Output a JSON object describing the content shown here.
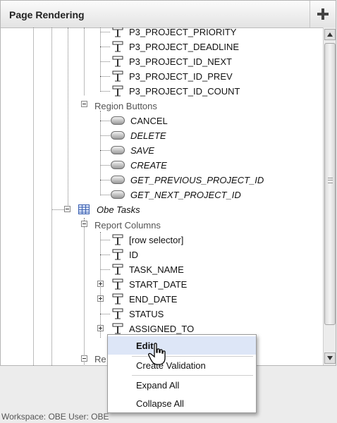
{
  "panel": {
    "title": "Page Rendering",
    "add_label": "+"
  },
  "tree": {
    "items_top": [
      "P3_PROJECT_PRIORITY",
      "P3_PROJECT_DEADLINE",
      "P3_PROJECT_ID_NEXT",
      "P3_PROJECT_ID_PREV",
      "P3_PROJECT_ID_COUNT"
    ],
    "region_buttons": {
      "label": "Region Buttons",
      "buttons": [
        {
          "label": "CANCEL",
          "italic": false
        },
        {
          "label": "DELETE",
          "italic": true
        },
        {
          "label": "SAVE",
          "italic": true
        },
        {
          "label": "CREATE",
          "italic": true
        },
        {
          "label": "GET_PREVIOUS_PROJECT_ID",
          "italic": true
        },
        {
          "label": "GET_NEXT_PROJECT_ID",
          "italic": true
        }
      ]
    },
    "region": {
      "label": "Obe Tasks"
    },
    "report_columns": {
      "label": "Report Columns",
      "columns": [
        "[row selector]",
        "ID",
        "TASK_NAME",
        "START_DATE",
        "END_DATE",
        "STATUS",
        "ASSIGNED_TO"
      ]
    },
    "next_group_partial": "Re"
  },
  "context_menu": {
    "items": [
      "Edit",
      "Create Validation",
      "Expand All",
      "Collapse All"
    ]
  },
  "status_bar": {
    "text": "Workspace: OBE User: OBE"
  }
}
